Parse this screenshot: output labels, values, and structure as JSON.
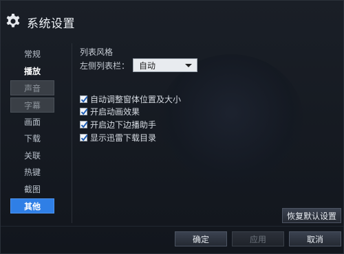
{
  "window": {
    "title": "系统设置",
    "icon": "gear-icon"
  },
  "sidebar": {
    "items": [
      {
        "label": "常规",
        "state": "normal"
      },
      {
        "label": "播放",
        "state": "bold"
      },
      {
        "label": "声音",
        "state": "dim"
      },
      {
        "label": "字幕",
        "state": "dim"
      },
      {
        "label": "画面",
        "state": "normal"
      },
      {
        "label": "下载",
        "state": "normal"
      },
      {
        "label": "关联",
        "state": "normal"
      },
      {
        "label": "热键",
        "state": "normal"
      },
      {
        "label": "截图",
        "state": "normal"
      },
      {
        "label": "其他",
        "state": "active"
      }
    ]
  },
  "content": {
    "section_title": "列表风格",
    "list_position_label": "左侧列表栏：",
    "list_position_value": "自动",
    "checkboxes": [
      {
        "label": "自动调整窗体位置及大小",
        "checked": true
      },
      {
        "label": "开启动画效果",
        "checked": true
      },
      {
        "label": "开启边下边播助手",
        "checked": true
      },
      {
        "label": "显示迅雷下载目录",
        "checked": true
      }
    ]
  },
  "buttons": {
    "reset": "恢复默认设置",
    "ok": "确定",
    "apply": "应用",
    "cancel": "取消"
  },
  "colors": {
    "accent": "#2f7fe6",
    "background": "#12161d"
  }
}
